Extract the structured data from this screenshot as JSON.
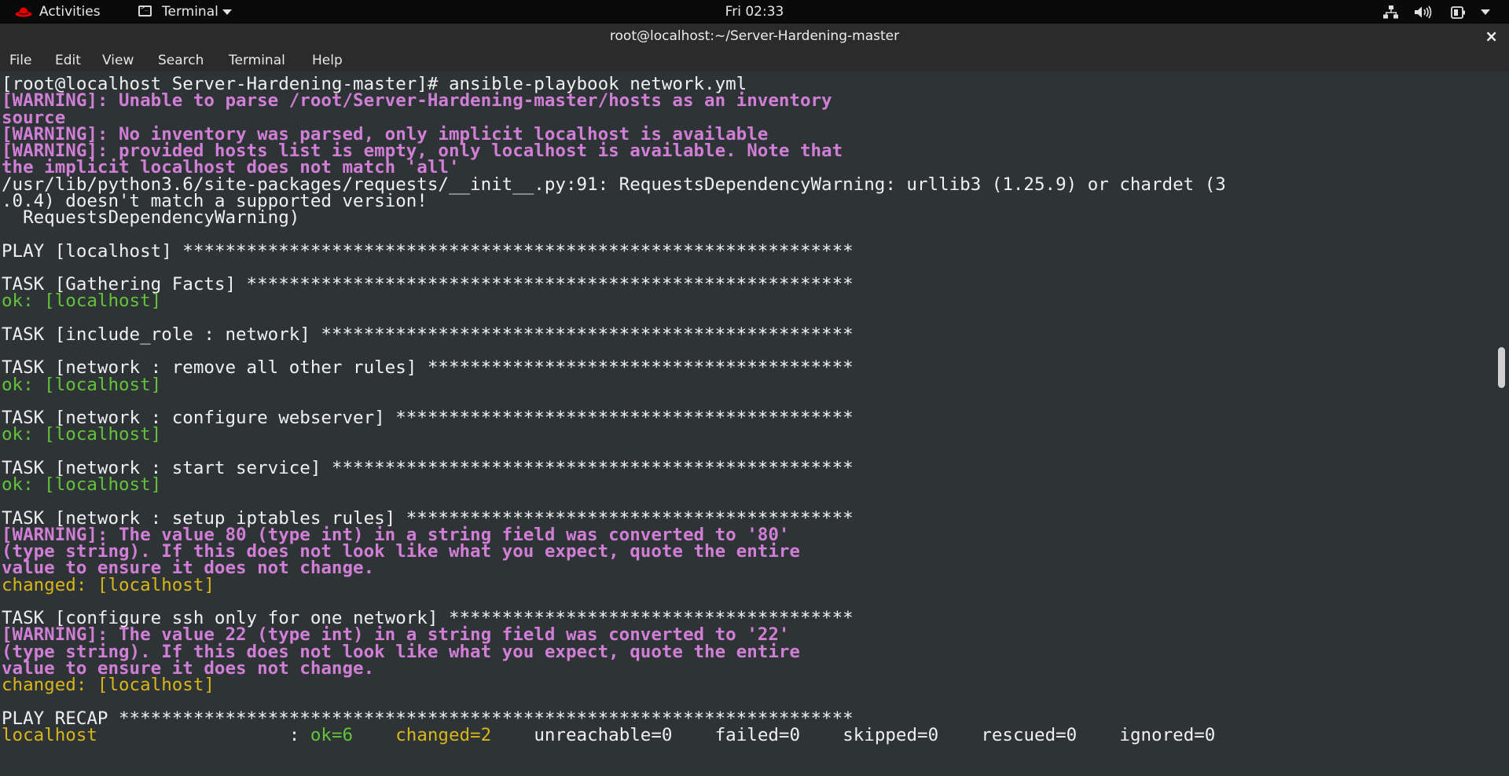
{
  "topbar": {
    "activities": "Activities",
    "app_menu": "Terminal",
    "clock": "Fri 02:33",
    "icons": [
      "network-icon",
      "volume-icon",
      "power-icon",
      "chevron-down-icon"
    ]
  },
  "window": {
    "title": "root@localhost:~/Server-Hardening-master",
    "close": "×"
  },
  "menubar": {
    "items": [
      "File",
      "Edit",
      "View",
      "Search",
      "Terminal",
      "Help"
    ]
  },
  "colors": {
    "terminal_bg": "#2e3436",
    "warning": "#d17ed6",
    "ok": "#64c23a",
    "changed": "#d9b618"
  },
  "terminal": {
    "lines": [
      "[root@localhost Server-Hardening-master]# ansible-playbook network.yml",
      "[WARNING]: Unable to parse /root/Server-Hardening-master/hosts as an inventory",
      "source",
      "[WARNING]: No inventory was parsed, only implicit localhost is available",
      "[WARNING]: provided hosts list is empty, only localhost is available. Note that",
      "the implicit localhost does not match 'all'",
      "/usr/lib/python3.6/site-packages/requests/__init__.py:91: RequestsDependencyWarning: urllib3 (1.25.9) or chardet (3",
      ".0.4) doesn't match a supported version!",
      "  RequestsDependencyWarning)",
      "",
      "PLAY [localhost] ***************************************************************",
      "",
      "TASK [Gathering Facts] *********************************************************",
      "ok: [localhost]",
      "",
      "TASK [include_role : network] **************************************************",
      "",
      "TASK [network : remove all other rules] ****************************************",
      "ok: [localhost]",
      "",
      "TASK [network : configure webserver] *******************************************",
      "ok: [localhost]",
      "",
      "TASK [network : start service] *************************************************",
      "ok: [localhost]",
      "",
      "TASK [network : setup iptables rules] ******************************************",
      "[WARNING]: The value 80 (type int) in a string field was converted to '80'",
      "(type string). If this does not look like what you expect, quote the entire",
      "value to ensure it does not change.",
      "changed: [localhost]",
      "",
      "TASK [configure ssh only for one network] **************************************",
      "[WARNING]: The value 22 (type int) in a string field was converted to '22'",
      "(type string). If this does not look like what you expect, quote the entire",
      "value to ensure it does not change.",
      "changed: [localhost]",
      "",
      "PLAY RECAP *********************************************************************"
    ],
    "line_styles": [
      "white",
      "warn",
      "warn",
      "warn",
      "warn",
      "warn",
      "white",
      "white",
      "white",
      "white",
      "white",
      "white",
      "white",
      "green",
      "white",
      "white",
      "white",
      "white",
      "green",
      "white",
      "white",
      "green",
      "white",
      "white",
      "green",
      "white",
      "white",
      "warn",
      "warn",
      "warn",
      "yellow",
      "white",
      "white",
      "warn",
      "warn",
      "warn",
      "yellow",
      "white",
      "white"
    ],
    "recap": {
      "host": "localhost",
      "sep": ":",
      "ok": "ok=6",
      "changed": "changed=2",
      "unreachable": "unreachable=0",
      "failed": "failed=0",
      "skipped": "skipped=0",
      "rescued": "rescued=0",
      "ignored": "ignored=0"
    }
  }
}
